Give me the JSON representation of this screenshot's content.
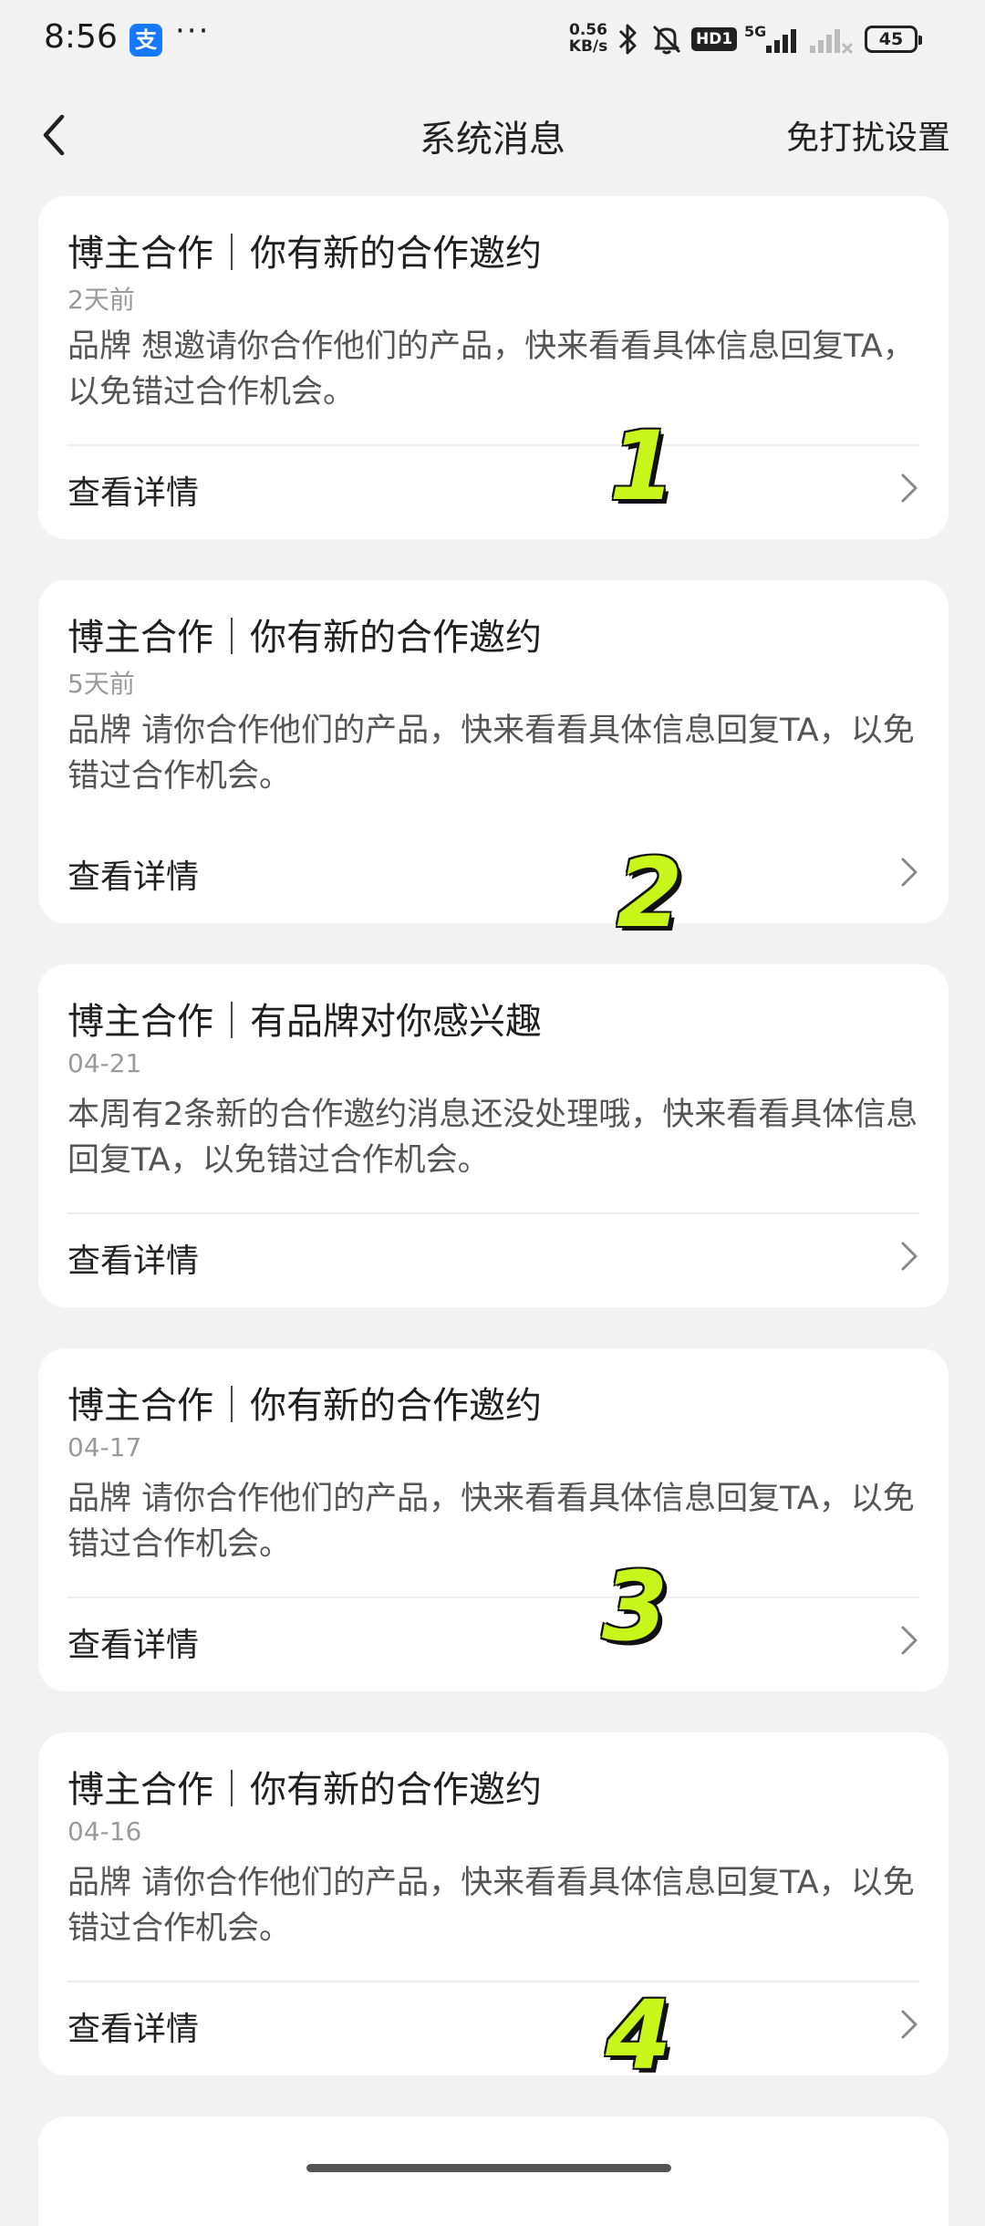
{
  "status_bar": {
    "time": "8:56",
    "alipay_glyph": "支",
    "more": "···",
    "net_speed": "0.56 KB/s",
    "hd_badge": "HD1",
    "signal_label": "5G",
    "battery": "45"
  },
  "nav": {
    "title": "系统消息",
    "dnd_label": "免打扰设置"
  },
  "messages": [
    {
      "title": "博主合作｜你有新的合作邀约",
      "time": "2天前",
      "body": "品牌              想邀请你合作他们的产品，快来看看具体信息回复TA，以免错过合作机会。",
      "link": "查看详情"
    },
    {
      "title": "博主合作｜你有新的合作邀约",
      "time": "5天前",
      "body": "品牌              请你合作他们的产品，快来看看具体信息回复TA，以免错过合作机会。",
      "link": "查看详情"
    },
    {
      "title": "博主合作｜有品牌对你感兴趣",
      "time": "04-21",
      "body": "本周有2条新的合作邀约消息还没处理哦，快来看看具体信息回复TA，以免错过合作机会。",
      "link": "查看详情"
    },
    {
      "title": "博主合作｜你有新的合作邀约",
      "time": "04-17",
      "body": "品牌                请你合作他们的产品，快来看看具体信息回复TA，以免错过合作机会。",
      "link": "查看详情"
    },
    {
      "title": "博主合作｜你有新的合作邀约",
      "time": "04-16",
      "body": "品牌                请你合作他们的产品，快来看看具体信息回复TA，以免错过合作机会。",
      "link": "查看详情"
    }
  ],
  "step_numbers": [
    "1",
    "2",
    "3",
    "4"
  ],
  "colors": {
    "background": "#f2f2f2",
    "card": "#ffffff",
    "step_number": "#c8f51a"
  }
}
